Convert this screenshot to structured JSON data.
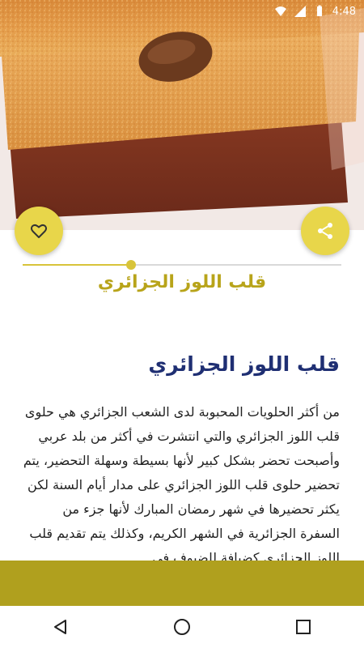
{
  "status": {
    "time": "4:48"
  },
  "hero": {
    "alt": "cake-photo"
  },
  "recipe": {
    "title": "قلب اللوز الجزائري",
    "heading": "قلب اللوز الجزائري",
    "body": "من أكثر الحلويات المحبوبة لدى الشعب الجزائري هي حلوى قلب اللوز الجزائري والتي انتشرت في أكثر من بلد عربي وأصبحت تحضر بشكل كبير لأنها بسيطة وسهلة التحضير، يتم تحضير حلوى قلب اللوز الجزائري على مدار أيام السنة لكن يكثر تحضيرها في شهر رمضان المبارك لأنها جزء من السفرة الجزائرية في الشهر الكريم، وكذلك يتم تقديم قلب اللوز الجزائري كضيافة للضيوف في"
  },
  "progress": {
    "fraction": 0.34
  },
  "colors": {
    "accent": "#d8c43a",
    "fab": "#e8d64a",
    "banner": "#b0a01e",
    "heading": "#1f2f73",
    "title": "#b8a41a"
  },
  "icons": {
    "favorite": "heart-outline-icon",
    "share": "share-icon",
    "back": "back-triangle-icon",
    "home": "home-circle-icon",
    "recents": "recents-square-icon"
  }
}
